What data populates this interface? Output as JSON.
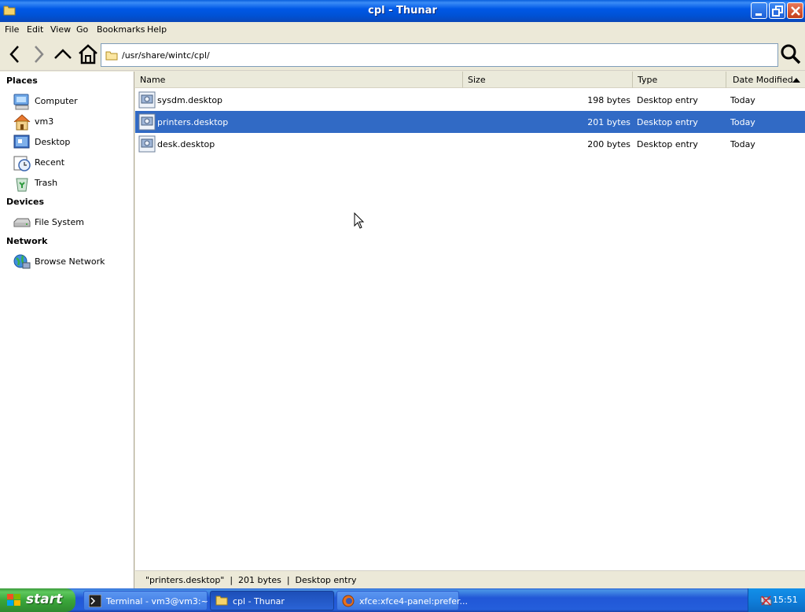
{
  "window": {
    "title": "cpl - Thunar"
  },
  "menu": [
    "File",
    "Edit",
    "View",
    "Go",
    "Bookmarks",
    "Help"
  ],
  "location": {
    "path": "/usr/share/wintc/cpl/"
  },
  "sidebar": {
    "places_heading": "Places",
    "places": [
      "Computer",
      "vm3",
      "Desktop",
      "Recent",
      "Trash"
    ],
    "devices_heading": "Devices",
    "devices": [
      "File System"
    ],
    "network_heading": "Network",
    "network": [
      "Browse Network"
    ]
  },
  "columns": {
    "name": "Name",
    "size": "Size",
    "type": "Type",
    "date": "Date Modified"
  },
  "files": [
    {
      "name": "sysdm.desktop",
      "size": "198 bytes",
      "type": "Desktop entry",
      "date": "Today",
      "selected": false
    },
    {
      "name": "printers.desktop",
      "size": "201 bytes",
      "type": "Desktop entry",
      "date": "Today",
      "selected": true
    },
    {
      "name": "desk.desktop",
      "size": "200 bytes",
      "type": "Desktop entry",
      "date": "Today",
      "selected": false
    }
  ],
  "status": "\"printers.desktop\"  |  201 bytes  |  Desktop entry",
  "taskbar": {
    "start_label": "start",
    "tasks": [
      "Terminal - vm3@vm3:~",
      "cpl - Thunar",
      "xfce:xfce4-panel:prefer..."
    ],
    "clock": "15:51"
  },
  "colors": {
    "selection": "#316ac5",
    "titlebar": "#0058e6",
    "taskbar": "#245edb"
  }
}
